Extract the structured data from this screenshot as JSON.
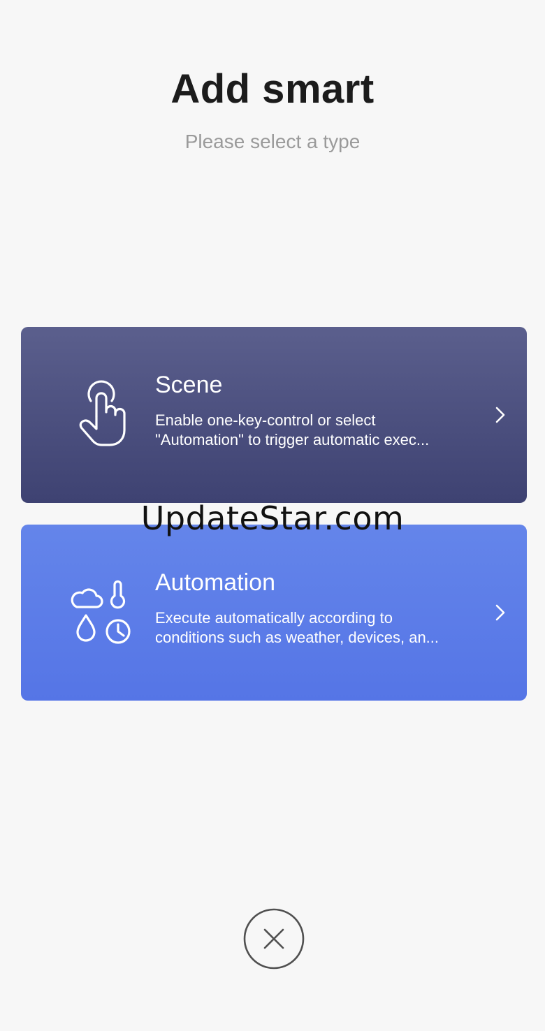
{
  "header": {
    "title": "Add smart",
    "subtitle": "Please select a type"
  },
  "cards": [
    {
      "title": "Scene",
      "desc_line1": "Enable one-key-control or select",
      "desc_line2": "\"Automation\" to trigger automatic exec...",
      "icon": "tap-hand-icon",
      "color": "#4e5281"
    },
    {
      "title": "Automation",
      "desc_line1": "Execute automatically according to",
      "desc_line2": "conditions such as weather, devices, an...",
      "icon": "weather-conditions-icon",
      "color": "#5d7de8"
    }
  ],
  "watermark": "UpdateStar.com",
  "close_icon": "close-icon"
}
